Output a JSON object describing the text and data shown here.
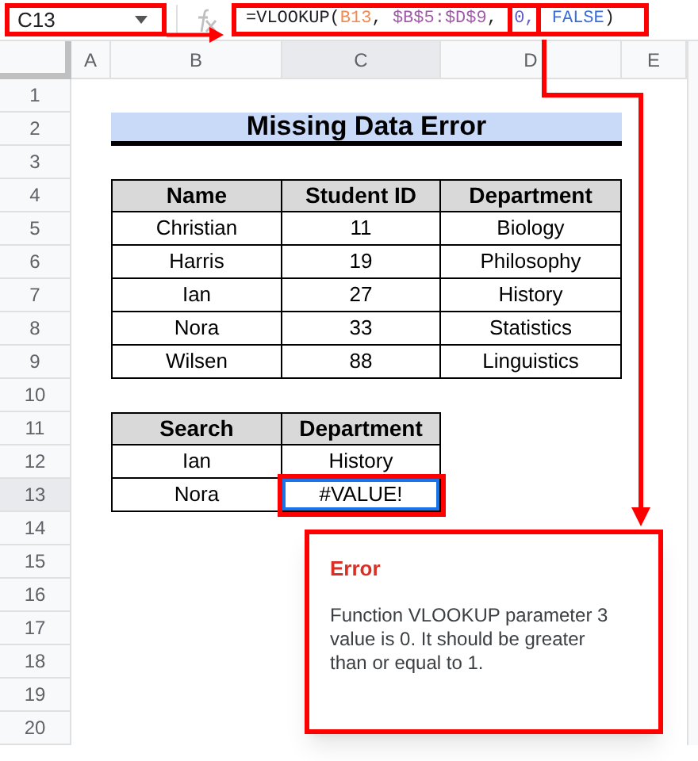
{
  "name_box": {
    "value": "C13",
    "highlighted": true
  },
  "formula": {
    "highlighted": true,
    "tokens": [
      {
        "text": "=VLOOKUP(",
        "color": "#202124",
        "highlighted": false
      },
      {
        "text": "B13",
        "color": "#f28b50",
        "highlighted": false
      },
      {
        "text": ", ",
        "color": "#202124",
        "highlighted": false
      },
      {
        "text": "$B$5:$D$9",
        "color": "#a05ca8",
        "highlighted": false
      },
      {
        "text": ", ",
        "color": "#202124",
        "highlighted": false
      },
      {
        "text": "0,",
        "color": "#5e5ec8",
        "highlighted": true
      },
      {
        "text": " FALSE",
        "color": "#3b6fd8",
        "highlighted": false
      },
      {
        "text": ")",
        "color": "#202124",
        "highlighted": false
      }
    ]
  },
  "columns": [
    {
      "label": "A",
      "selected": false
    },
    {
      "label": "B",
      "selected": false
    },
    {
      "label": "C",
      "selected": true
    },
    {
      "label": "D",
      "selected": false
    },
    {
      "label": "E",
      "selected": false
    }
  ],
  "rows": [
    {
      "label": "1",
      "selected": false
    },
    {
      "label": "2",
      "selected": false
    },
    {
      "label": "3",
      "selected": false
    },
    {
      "label": "4",
      "selected": false
    },
    {
      "label": "5",
      "selected": false
    },
    {
      "label": "6",
      "selected": false
    },
    {
      "label": "7",
      "selected": false
    },
    {
      "label": "8",
      "selected": false
    },
    {
      "label": "9",
      "selected": false
    },
    {
      "label": "10",
      "selected": false
    },
    {
      "label": "11",
      "selected": false
    },
    {
      "label": "12",
      "selected": false
    },
    {
      "label": "13",
      "selected": true
    },
    {
      "label": "14",
      "selected": false
    },
    {
      "label": "15",
      "selected": false
    },
    {
      "label": "16",
      "selected": false
    },
    {
      "label": "17",
      "selected": false
    },
    {
      "label": "18",
      "selected": false
    },
    {
      "label": "19",
      "selected": false
    },
    {
      "label": "20",
      "selected": false
    }
  ],
  "title": "Missing Data Error",
  "student_table": {
    "columns": [
      "Name",
      "Student ID",
      "Department"
    ],
    "rows": [
      [
        "Christian",
        "11",
        "Biology"
      ],
      [
        "Harris",
        "19",
        "Philosophy"
      ],
      [
        "Ian",
        "27",
        "History"
      ],
      [
        "Nora",
        "33",
        "Statistics"
      ],
      [
        "Wilsen",
        "88",
        "Linguistics"
      ]
    ]
  },
  "search_table": {
    "columns": [
      "Search",
      "Department"
    ],
    "rows": [
      {
        "cells": [
          {
            "text": "Ian",
            "selected": false,
            "highlighted": false
          },
          {
            "text": "History",
            "selected": false,
            "highlighted": false
          }
        ]
      },
      {
        "cells": [
          {
            "text": "Nora",
            "selected": false,
            "highlighted": false
          },
          {
            "text": "#VALUE!",
            "selected": true,
            "highlighted": true
          }
        ]
      }
    ]
  },
  "error_tooltip": {
    "title": "Error",
    "message": "Function VLOOKUP parameter 3 value is 0. It should be greater than or equal to 1."
  }
}
